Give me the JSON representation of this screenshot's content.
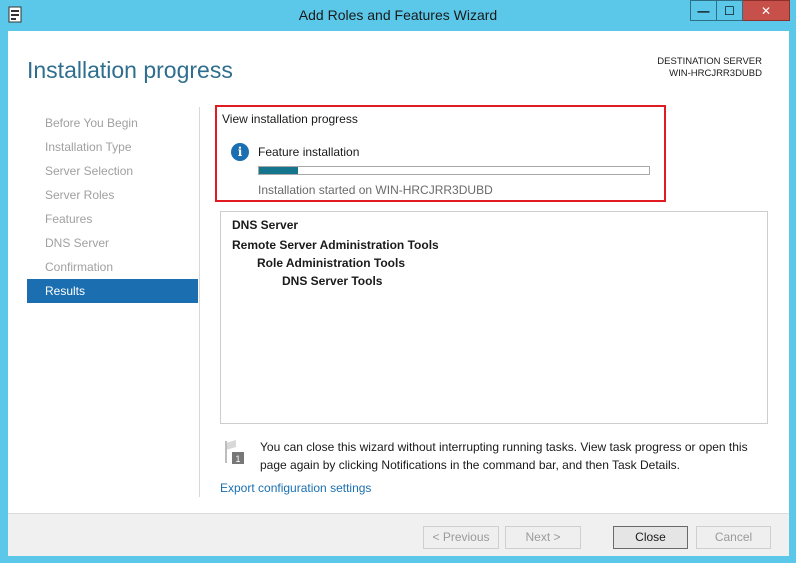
{
  "window": {
    "title": "Add Roles and Features Wizard",
    "controls": {
      "minimize": "—",
      "maximize": "☐",
      "close": "✕"
    }
  },
  "header": {
    "title": "Installation progress",
    "destination_label": "DESTINATION SERVER",
    "destination_server": "WIN-HRCJRR3DUBD"
  },
  "nav": {
    "items": [
      {
        "label": "Before You Begin",
        "active": false
      },
      {
        "label": "Installation Type",
        "active": false
      },
      {
        "label": "Server Selection",
        "active": false
      },
      {
        "label": "Server Roles",
        "active": false
      },
      {
        "label": "Features",
        "active": false
      },
      {
        "label": "DNS Server",
        "active": false
      },
      {
        "label": "Confirmation",
        "active": false
      },
      {
        "label": "Results",
        "active": true
      }
    ]
  },
  "progress": {
    "heading": "View installation progress",
    "info_icon": "i",
    "feature_label": "Feature installation",
    "percent": 10,
    "status": "Installation started on WIN-HRCJRR3DUBD"
  },
  "results": {
    "items": [
      {
        "label": "DNS Server",
        "level": 0
      },
      {
        "label": "Remote Server Administration Tools",
        "level": 0
      },
      {
        "label": "Role Administration Tools",
        "level": 1
      },
      {
        "label": "DNS Server Tools",
        "level": 2
      }
    ]
  },
  "note": {
    "icon": "notification-flag-icon",
    "text": "You can close this wizard without interrupting running tasks. View task progress or open this page again by clicking Notifications in the command bar, and then Task Details."
  },
  "export_link": "Export configuration settings",
  "footer": {
    "previous": "< Previous",
    "next": "Next >",
    "close": "Close",
    "cancel": "Cancel"
  },
  "colors": {
    "accent": "#1b6fb0",
    "highlight_border": "#e01b22",
    "progress_fill": "#15758d",
    "title_bar": "#5bc8ea"
  }
}
